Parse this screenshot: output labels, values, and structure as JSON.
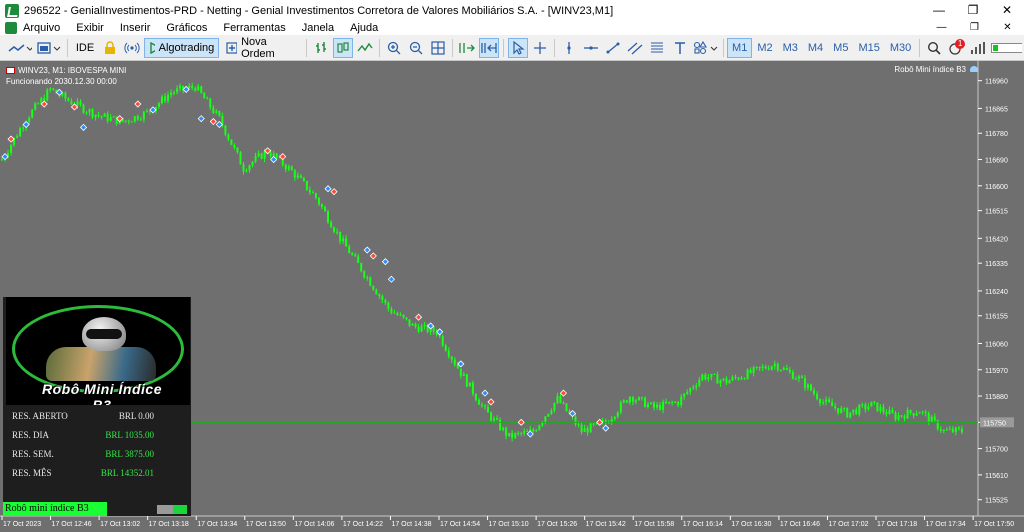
{
  "window": {
    "title": "296522 - GenialInvestimentos-PRD - Netting - Genial Investimentos Corretora de Valores Mobiliários S.A. - [WINV23,M1]",
    "minimize": "—",
    "maximize": "❐",
    "close": "✕"
  },
  "menu": {
    "items": [
      "Arquivo",
      "Exibir",
      "Inserir",
      "Gráficos",
      "Ferramentas",
      "Janela",
      "Ajuda"
    ],
    "mdi_minimize": "—",
    "mdi_restore": "❐",
    "mdi_close": "✕"
  },
  "toolbar": {
    "ide_label": "IDE",
    "algotrading_label": "Algotrading",
    "new_order_label": "Nova Ordem",
    "timeframes": [
      "M1",
      "M2",
      "M3",
      "M4",
      "M5",
      "M15",
      "M30"
    ],
    "active_timeframe": "M1",
    "notification_count": "1"
  },
  "chart": {
    "symbol_line": "WINV23, M1:  IBOVESPA MINI",
    "status_line": "Funcionando 2030.12.30 00:00",
    "robot_name_label": "Robô Mini índice B3",
    "current_price_label": "115750"
  },
  "chart_data": {
    "type": "candlestick",
    "price_axis_labels": [
      116960,
      116865,
      116780,
      116690,
      116600,
      116515,
      116420,
      116335,
      116240,
      116155,
      116060,
      115970,
      115880,
      115790,
      115700,
      115610,
      115525
    ],
    "time_axis_labels": [
      "17 Oct 2023",
      "17 Oct 12:46",
      "17 Oct 13:02",
      "17 Oct 13:18",
      "17 Oct 13:34",
      "17 Oct 13:50",
      "17 Oct 14:06",
      "17 Oct 14:22",
      "17 Oct 14:38",
      "17 Oct 14:54",
      "17 Oct 15:10",
      "17 Oct 15:26",
      "17 Oct 15:42",
      "17 Oct 15:58",
      "17 Oct 16:14",
      "17 Oct 16:30",
      "17 Oct 16:46",
      "17 Oct 17:02",
      "17 Oct 17:18",
      "17 Oct 17:34",
      "17 Oct 17:50"
    ],
    "ylim": [
      115500,
      117000
    ],
    "approx_close_path": [
      {
        "t": "12:30",
        "v": 116690
      },
      {
        "t": "12:38",
        "v": 116830
      },
      {
        "t": "12:46",
        "v": 116930
      },
      {
        "t": "12:54",
        "v": 116880
      },
      {
        "t": "13:02",
        "v": 116840
      },
      {
        "t": "13:10",
        "v": 116820
      },
      {
        "t": "13:18",
        "v": 116850
      },
      {
        "t": "13:26",
        "v": 116920
      },
      {
        "t": "13:34",
        "v": 116940
      },
      {
        "t": "13:42",
        "v": 116830
      },
      {
        "t": "13:50",
        "v": 116660
      },
      {
        "t": "13:58",
        "v": 116720
      },
      {
        "t": "14:06",
        "v": 116650
      },
      {
        "t": "14:14",
        "v": 116560
      },
      {
        "t": "14:22",
        "v": 116420
      },
      {
        "t": "14:30",
        "v": 116300
      },
      {
        "t": "14:38",
        "v": 116180
      },
      {
        "t": "14:46",
        "v": 116120
      },
      {
        "t": "14:54",
        "v": 116100
      },
      {
        "t": "15:02",
        "v": 115960
      },
      {
        "t": "15:10",
        "v": 115830
      },
      {
        "t": "15:18",
        "v": 115740
      },
      {
        "t": "15:26",
        "v": 115760
      },
      {
        "t": "15:34",
        "v": 115870
      },
      {
        "t": "15:42",
        "v": 115760
      },
      {
        "t": "15:50",
        "v": 115790
      },
      {
        "t": "15:58",
        "v": 115880
      },
      {
        "t": "16:06",
        "v": 115840
      },
      {
        "t": "16:14",
        "v": 115860
      },
      {
        "t": "16:22",
        "v": 115950
      },
      {
        "t": "16:30",
        "v": 115930
      },
      {
        "t": "16:38",
        "v": 115960
      },
      {
        "t": "16:46",
        "v": 115990
      },
      {
        "t": "16:54",
        "v": 115940
      },
      {
        "t": "17:02",
        "v": 115860
      },
      {
        "t": "17:10",
        "v": 115820
      },
      {
        "t": "17:18",
        "v": 115850
      },
      {
        "t": "17:26",
        "v": 115810
      },
      {
        "t": "17:34",
        "v": 115830
      },
      {
        "t": "17:42",
        "v": 115760
      }
    ],
    "horizontal_line": 115790,
    "colors": {
      "background": "#6f6f6f",
      "candle": "#19ff19",
      "grid": "#808080",
      "level_line": "#19b019"
    }
  },
  "ea_panel": {
    "rows": [
      {
        "label": "RES. ABERTO",
        "value": "BRL 0.00",
        "color": "white"
      },
      {
        "label": "RES. DIA",
        "value": "BRL 1035.00",
        "color": "green"
      },
      {
        "label": "RES. SEM.",
        "value": "BRL 3875.00",
        "color": "green"
      },
      {
        "label": "RES. MÊS",
        "value": "BRL 14352.01",
        "color": "green"
      }
    ],
    "footer_name": "Robô mini índice B3"
  }
}
